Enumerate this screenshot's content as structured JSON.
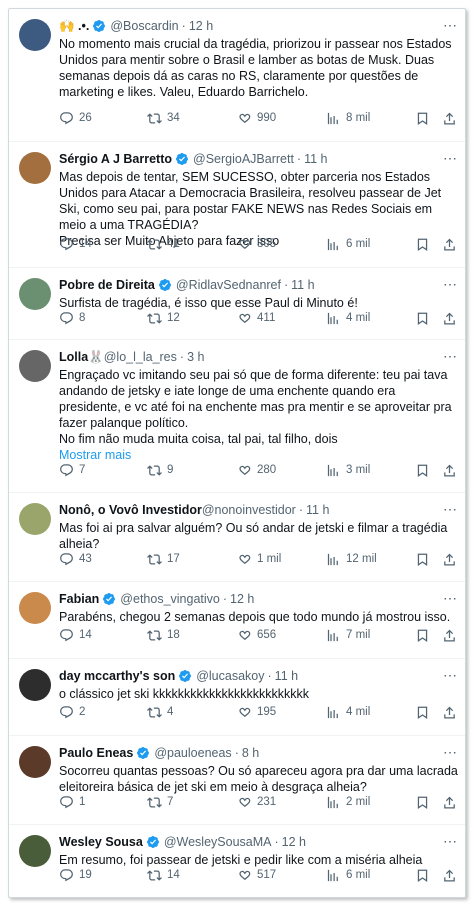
{
  "colors": {
    "link": "#1d9bf0",
    "verified": "#1d9bf0",
    "muted": "#536471",
    "text": "#0f1419"
  },
  "show_more_label": "Mostrar mais",
  "tweets": [
    {
      "name": "🙌 .•.",
      "handle": "@Boscardin",
      "time": "12 h",
      "verified": true,
      "lines": [
        "No momento mais crucial da tragédia, priorizou ir passear nos Estados Unidos para mentir sobre o Brasil e lamber as botas de Musk. Duas semanas depois dá as caras no RS, claramente por questões de marketing e likes. Valeu, Eduardo Barrichelo."
      ],
      "replies": "26",
      "retweets": "34",
      "likes": "990",
      "views": "8 mil",
      "avatar_icon": "avatar-photo"
    },
    {
      "name": "Sérgio A J Barretto",
      "handle": "@SergioAJBarrett",
      "time": "11 h",
      "verified": true,
      "lines": [
        "Mas depois de tentar, SEM SUCESSO, obter parceria nos Estados Unidos para Atacar a Democracia Brasileira, resolveu passear de Jet Ski, como seu pai, para postar FAKE NEWS nas Redes Sociais em meio a uma TRAGÉDIA?",
        "Precisa ser Muito Abjeto para fazer isso"
      ],
      "replies": "14",
      "retweets": "41",
      "likes": "805",
      "views": "6 mil",
      "avatar_icon": "avatar-photo"
    },
    {
      "name": "Pobre de Direita",
      "handle": "@RidlavSednanref",
      "time": "11 h",
      "verified": true,
      "lines": [
        "Surfista de tragédia, é isso que esse Paul di Minuto é!"
      ],
      "replies": "8",
      "retweets": "12",
      "likes": "411",
      "views": "4 mil",
      "avatar_icon": "avatar-photo"
    },
    {
      "name": "Lolla🐰",
      "handle": "@lo_l_la_res",
      "time": "3 h",
      "verified": false,
      "lines": [
        "Engraçado vc imitando seu pai só que de forma diferente: teu pai tava andando de jetsky e iate longe de uma enchente quando era presidente, e vc até foi na enchente mas pra mentir e se aproveitar pra fazer palanque político.",
        "No fim não muda muita coisa, tal pai, tal filho, dois"
      ],
      "show_more": true,
      "replies": "7",
      "retweets": "9",
      "likes": "280",
      "views": "3 mil",
      "avatar_icon": "avatar-photo"
    },
    {
      "name": "Nonô, o Vovô Investidor",
      "handle": "@nonoinvestidor",
      "time": "11 h",
      "verified": false,
      "lines": [
        "Mas foi ai pra salvar alguém? Ou só andar de jetski e filmar a tragédia alheia?"
      ],
      "replies": "43",
      "retweets": "17",
      "likes": "1 mil",
      "views": "12 mil",
      "avatar_icon": "avatar-photo"
    },
    {
      "name": "Fabian",
      "handle": "@ethos_vingativo",
      "time": "12 h",
      "verified": true,
      "lines": [
        "Parabéns, chegou 2 semanas depois que todo mundo já mostrou isso."
      ],
      "replies": "14",
      "retweets": "18",
      "likes": "656",
      "views": "7 mil",
      "avatar_icon": "avatar-photo"
    },
    {
      "name": "day mccarthy's son",
      "handle": "@lucasakoy",
      "time": "11 h",
      "verified": true,
      "lines": [
        "o clássico jet ski kkkkkkkkkkkkkkkkkkkkkkkkk"
      ],
      "replies": "2",
      "retweets": "4",
      "likes": "195",
      "views": "4 mil",
      "avatar_icon": "avatar-photo"
    },
    {
      "name": "Paulo Eneas",
      "handle": "@pauloeneas",
      "time": "8 h",
      "verified": true,
      "lines": [
        "Socorreu quantas pessoas? Ou só apareceu agora pra dar uma lacrada eleitoreira básica de jet ski em meio à desgraça alheia?"
      ],
      "replies": "1",
      "retweets": "7",
      "likes": "231",
      "views": "2 mil",
      "avatar_icon": "avatar-photo"
    },
    {
      "name": "Wesley Sousa",
      "handle": "@WesleySousaMA",
      "time": "12 h",
      "verified": true,
      "lines": [
        "Em resumo, foi passear de jetski e pedir like com a miséria alheia"
      ],
      "replies": "19",
      "retweets": "14",
      "likes": "517",
      "views": "6 mil",
      "avatar_icon": "avatar-photo"
    }
  ]
}
